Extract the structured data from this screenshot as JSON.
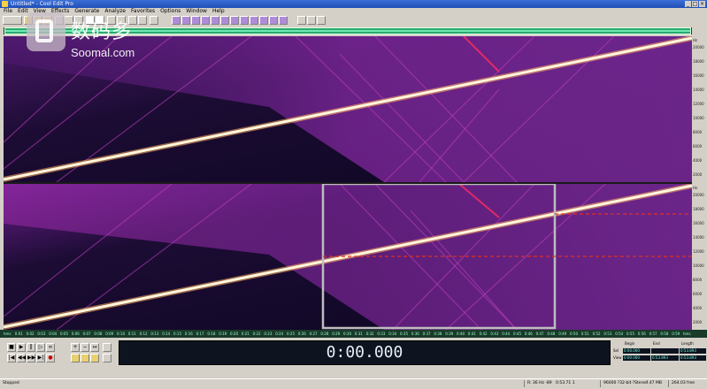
{
  "window": {
    "title": "Untitled* - Cool Edit Pro"
  },
  "menu": [
    "File",
    "Edit",
    "View",
    "Effects",
    "Generate",
    "Analyze",
    "Favorites",
    "Options",
    "Window",
    "Help"
  ],
  "watermark": {
    "chinese": "数码多",
    "english": "Soomal.com"
  },
  "ruler_labels": [
    "Hz",
    "20000",
    "18000",
    "16000",
    "14000",
    "12000",
    "10000",
    "8000",
    "6000",
    "4000",
    "2000"
  ],
  "time_ruler": [
    "hms",
    "0:01",
    "0:02",
    "0:03",
    "0:04",
    "0:05",
    "0:06",
    "0:07",
    "0:08",
    "0:09",
    "0:10",
    "0:11",
    "0:12",
    "0:13",
    "0:14",
    "0:15",
    "0:16",
    "0:17",
    "0:18",
    "0:19",
    "0:20",
    "0:21",
    "0:22",
    "0:23",
    "0:24",
    "0:25",
    "0:26",
    "0:27",
    "0:28",
    "0:29",
    "0:30",
    "0:31",
    "0:32",
    "0:33",
    "0:34",
    "0:35",
    "0:36",
    "0:37",
    "0:38",
    "0:39",
    "0:40",
    "0:41",
    "0:42",
    "0:43",
    "0:44",
    "0:45",
    "0:46",
    "0:47",
    "0:48",
    "0:49",
    "0:50",
    "0:51",
    "0:52",
    "0:53",
    "0:54",
    "0:55",
    "0:56",
    "0:57",
    "0:58",
    "0:59",
    "hms"
  ],
  "time_display": "0:00.000",
  "selection": {
    "headers": {
      "begin": "Begin",
      "end": "End",
      "length": "Length"
    },
    "sel_label": "Sel",
    "view_label": "View",
    "sel": {
      "begin": "0:00.000",
      "end": "",
      "length": "0:53.893"
    },
    "view": {
      "begin": "0:00.000",
      "end": "0:53.893",
      "length": "0:53.893"
    }
  },
  "status": {
    "state": "Stopped",
    "level": "R: 36 Hz -89",
    "position": "0:53.71 1",
    "format": "96000 ?32-bit ?Stereo",
    "size": "?.47 MB",
    "free": "264.03 free"
  },
  "colors": {
    "spectrum_bg": "#12082a",
    "spectrum_mid": "#5a1a78",
    "sweep": "#fff2cc",
    "marker": "#d83020",
    "selection_box": "#bdbdbd"
  },
  "icons": [
    "app-icon",
    "minimize-icon",
    "maximize-icon",
    "close-icon",
    "new-file-icon",
    "open-icon",
    "save-icon",
    "cut-icon",
    "copy-icon",
    "paste-icon",
    "zoom-icon",
    "play-icon",
    "stop-icon",
    "pause-icon",
    "loop-icon",
    "record-icon"
  ]
}
